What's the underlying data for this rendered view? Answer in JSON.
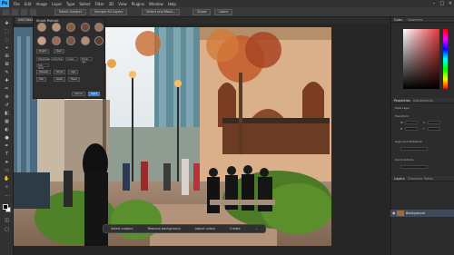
{
  "menubar": {
    "logo": "Ps",
    "items": [
      "File",
      "Edit",
      "Image",
      "Layer",
      "Type",
      "Select",
      "Filter",
      "3D",
      "View",
      "Plugins",
      "Window",
      "Help"
    ]
  },
  "optbar": {
    "select_subject": "Select Subject",
    "sample": "Sample All Layers",
    "select_mask": "Select and Mask...",
    "share": "Share",
    "learn": "Learn"
  },
  "document": {
    "tab_label": "DSC08412.jpg @ 33.3% (RGB/8#)"
  },
  "neural_filter": {
    "title": "Smart Portrait",
    "buttons": [
      "Bright",
      "Dark",
      "Glasses",
      "Smile",
      "Age",
      "Hair",
      "Gaze",
      "Head"
    ],
    "rows": [
      "Happiness",
      "Surprise",
      "Anger",
      "Facial age",
      "Hair thick"
    ],
    "cancel": "Cancel",
    "apply": "Apply"
  },
  "taskbar": {
    "items": [
      "Select subject",
      "Remove background",
      "Adjust colors",
      "Create",
      "..."
    ]
  },
  "right_panel": {
    "color_tab": "Color",
    "swatches_tab": "Swatches",
    "properties_tab": "Properties",
    "adjustments_tab": "Adjustments",
    "props_title": "Pixel Layer",
    "transform": "Transform",
    "w": "W",
    "h": "H",
    "x": "X",
    "y": "Y",
    "align": "Align and Distribute",
    "quick_actions": "Quick Actions",
    "layers_tab": "Layers",
    "channels_tab": "Channels",
    "paths_tab": "Paths",
    "layer_name": "Background"
  },
  "colors": {
    "accent": "#31a8ff",
    "picker_hue": "#e4373b"
  }
}
